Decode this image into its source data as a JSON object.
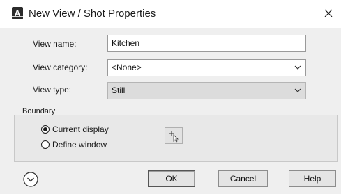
{
  "window": {
    "title": "New View / Shot Properties",
    "app_icon_letter": "A",
    "app_icon": "autocad-app-icon",
    "close_icon": "close-icon"
  },
  "form": {
    "view_name_label": "View name:",
    "view_name_value": "Kitchen",
    "view_category_label": "View category:",
    "view_category_value": "<None>",
    "view_type_label": "View type:",
    "view_type_value": "Still"
  },
  "boundary": {
    "group_label": "Boundary",
    "current_display_label": "Current display",
    "current_display_selected": true,
    "define_window_label": "Define window",
    "define_window_selected": false,
    "pick_icon": "pick-window-cursor-icon"
  },
  "footer": {
    "expand_icon": "chevron-down-circle-icon",
    "ok_label": "OK",
    "cancel_label": "Cancel",
    "help_label": "Help"
  }
}
